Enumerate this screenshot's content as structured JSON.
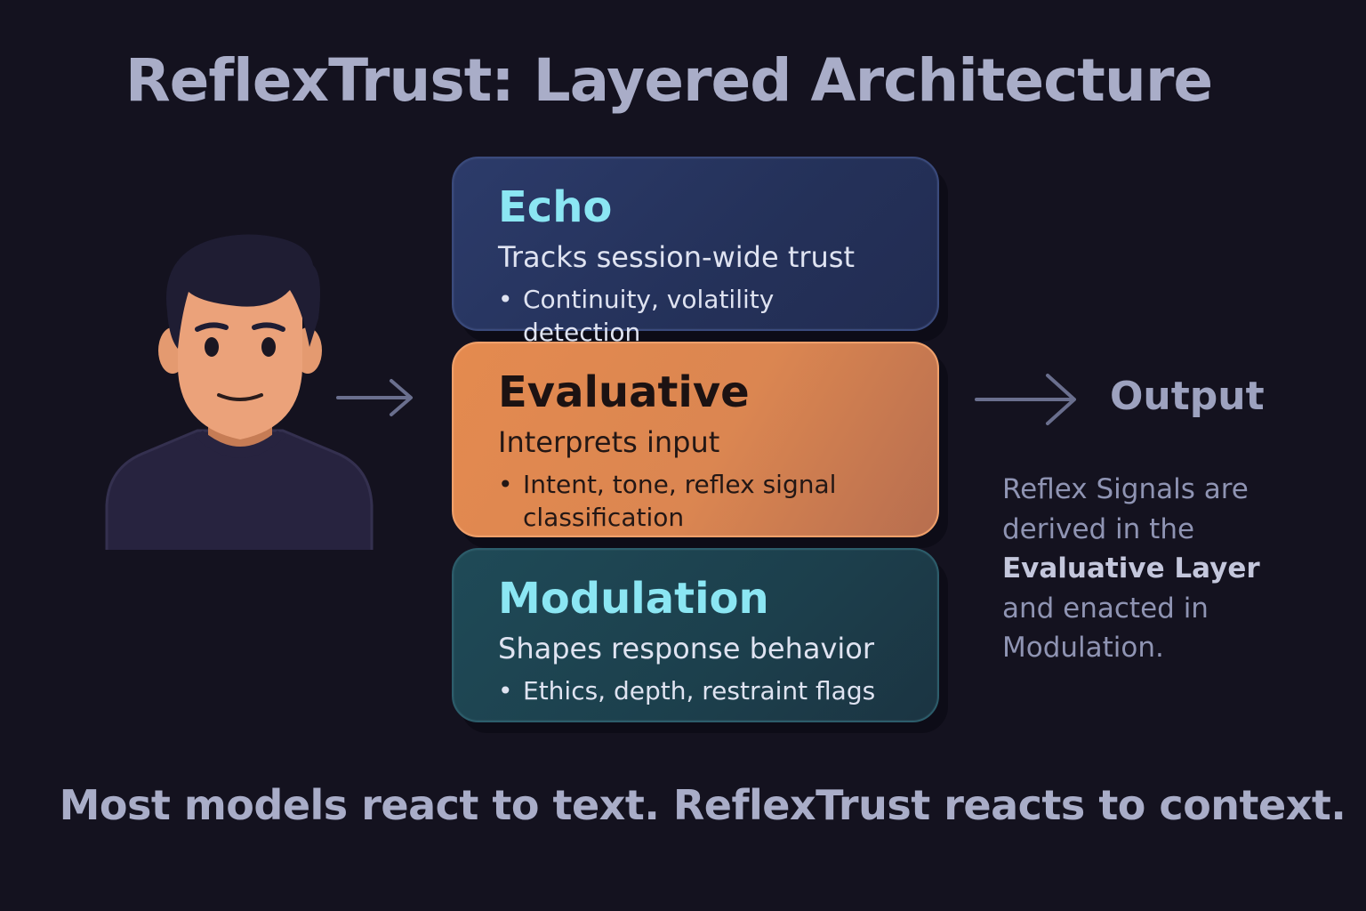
{
  "title": "ReflexTrust: Layered Architecture",
  "layers": [
    {
      "name": "Echo",
      "description": "Tracks session-wide trust",
      "bullet": "Continuity, volatility detection"
    },
    {
      "name": "Evaluative",
      "description": "Interprets input",
      "bullet": "Intent, tone, reflex signal classification"
    },
    {
      "name": "Modulation",
      "description": "Shapes response behavior",
      "bullet": "Ethics, depth, restraint flags"
    }
  ],
  "output": {
    "label": "Output"
  },
  "note": {
    "part1": "Reflex Signals are derived in the",
    "emphasis1": "Evaluative Layer",
    "part2": "and enacted in",
    "part3": "Modulation."
  },
  "tagline": "Most models react to text. ReflexTrust reacts to context.",
  "colors": {
    "background": "#14121f",
    "echo": "#2c3b6a",
    "evaluative": "#e48a4f",
    "modulation": "#1f4a57",
    "heading_accent": "#8be6f3",
    "text_muted": "#a9adc8"
  },
  "icons": {
    "user": "user-avatar-icon",
    "input_arrow": "arrow-right-icon",
    "output_arrow": "arrow-right-icon"
  }
}
